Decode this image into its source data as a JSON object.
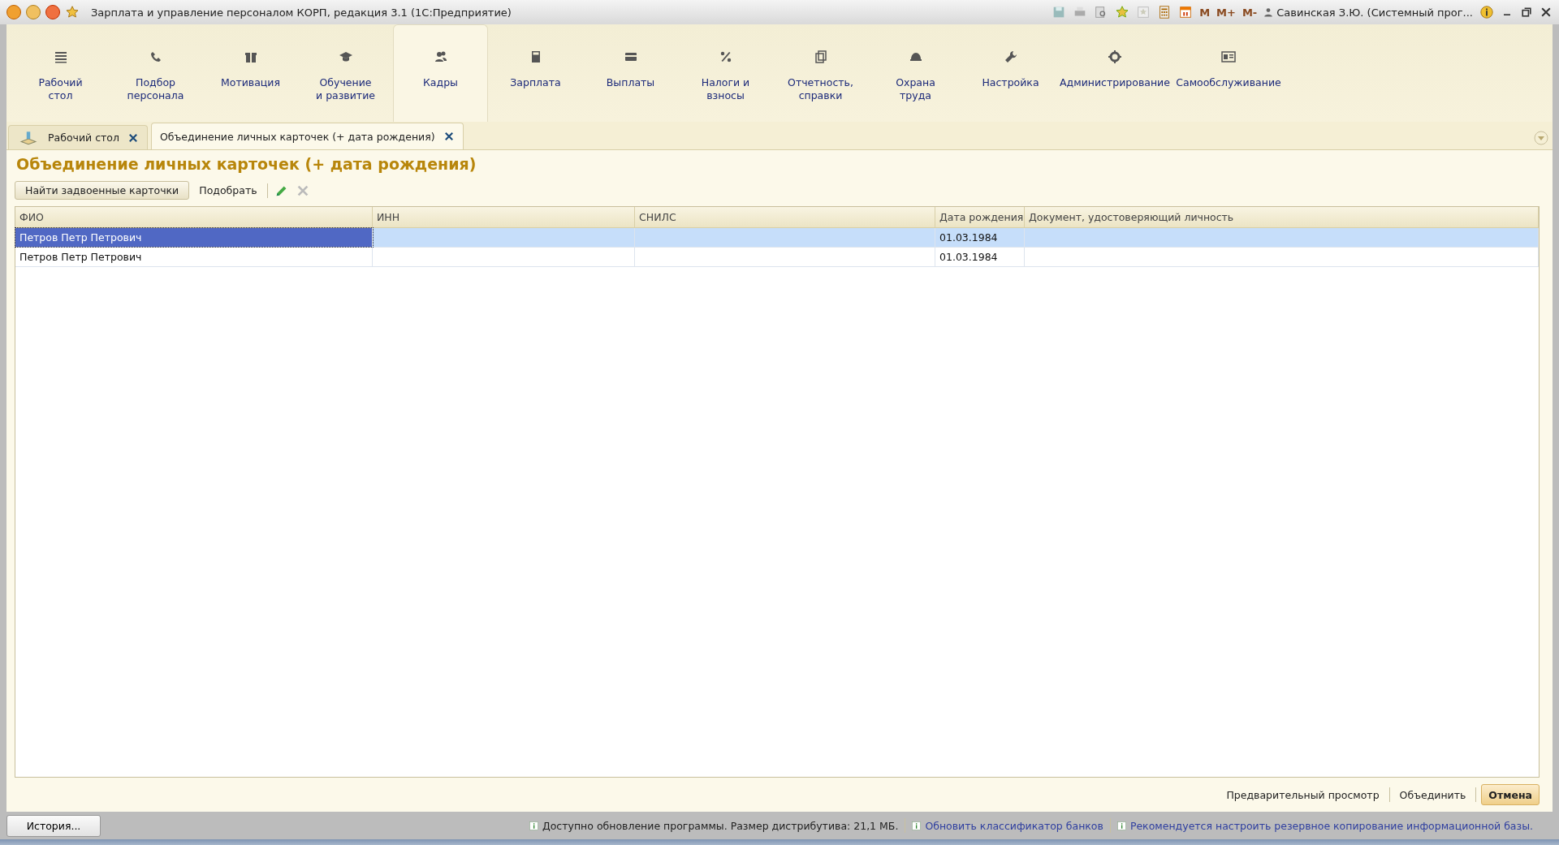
{
  "window": {
    "title": "Зарплата и управление персоналом КОРП, редакция 3.1  (1С:Предприятие)",
    "memory_buttons": [
      "M",
      "M+",
      "M-"
    ],
    "user": "Савинская З.Ю. (Системный прог..."
  },
  "sections": [
    {
      "label": "Рабочий\nстол",
      "selected": false
    },
    {
      "label": "Подбор\nперсонала",
      "selected": false
    },
    {
      "label": "Мотивация",
      "selected": false
    },
    {
      "label": "Обучение\nи развитие",
      "selected": false
    },
    {
      "label": "Кадры",
      "selected": true
    },
    {
      "label": "Зарплата",
      "selected": false
    },
    {
      "label": "Выплаты",
      "selected": false
    },
    {
      "label": "Налоги и\nвзносы",
      "selected": false
    },
    {
      "label": "Отчетность,\nсправки",
      "selected": false
    },
    {
      "label": "Охрана\nтруда",
      "selected": false
    },
    {
      "label": "Настройка",
      "selected": false
    },
    {
      "label": "Администрирование",
      "selected": false
    },
    {
      "label": "Самообслуживание",
      "selected": false
    }
  ],
  "open_tabs": [
    {
      "label": "Рабочий стол",
      "selected": false
    },
    {
      "label": "Объединение личных карточек (+ дата рождения)",
      "selected": true
    }
  ],
  "form": {
    "title": "Объединение личных карточек (+ дата рождения)",
    "toolbar": {
      "find_button": "Найти задвоенные карточки",
      "pick_button": "Подобрать"
    },
    "table": {
      "columns": [
        "ФИО",
        "ИНН",
        "СНИЛС",
        "Дата рождения",
        "Документ, удостоверяющий личность"
      ],
      "rows": [
        {
          "cells": [
            "Петров Петр Петрович",
            "",
            "",
            "01.03.1984",
            ""
          ],
          "selected": true
        },
        {
          "cells": [
            "Петров Петр Петрович",
            "",
            "",
            "01.03.1984",
            ""
          ],
          "selected": false
        }
      ]
    },
    "buttons": [
      {
        "label": "Предварительный просмотр",
        "default": false
      },
      {
        "label": "Объединить",
        "default": false
      },
      {
        "label": "Отмена",
        "default": true
      }
    ]
  },
  "status_bar": {
    "history_button": "История...",
    "messages": [
      {
        "text": "Доступно обновление программы. Размер дистрибутива: 21,1 МБ.",
        "kind": "info"
      },
      {
        "text": "Обновить классификатор банков",
        "kind": "link"
      },
      {
        "text": "Рекомендуется настроить резервное копирование информационной базы.",
        "kind": "link"
      }
    ]
  }
}
